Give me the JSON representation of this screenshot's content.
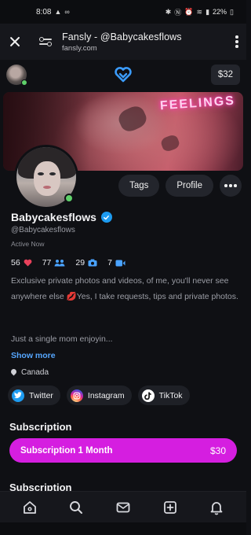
{
  "status_bar": {
    "time": "8:08",
    "battery": "22%"
  },
  "browser": {
    "title": "Fansly - @Babycakesflows",
    "url": "fansly.com"
  },
  "topbar": {
    "balance": "$32"
  },
  "banner": {
    "neon_text": "FEELINGS"
  },
  "profile": {
    "name": "Babycakesflows",
    "handle": "@Babycakesflows",
    "status": "Active Now",
    "stats": {
      "likes": "56",
      "followers": "77",
      "photos": "29",
      "videos": "7"
    },
    "bio_line1": "Exclusive private photos and videos, of me, you'll never see anywhere else ",
    "bio_line2": "Yes, I take requests, tips and private photos.",
    "bio_line3": "Just a single mom enjoyin...",
    "show_more": "Show more",
    "location": "Canada"
  },
  "actions": {
    "tags": "Tags",
    "profile": "Profile"
  },
  "socials": {
    "twitter": "Twitter",
    "instagram": "Instagram",
    "tiktok": "TikTok"
  },
  "subscription": {
    "title": "Subscription",
    "option_label": "Subscription 1 Month",
    "option_price": "$30",
    "title2": "Subscription"
  },
  "colors": {
    "accent": "#d51ee0",
    "link": "#56a7ff",
    "verified": "#1d9bf0",
    "online": "#5fd06a"
  }
}
